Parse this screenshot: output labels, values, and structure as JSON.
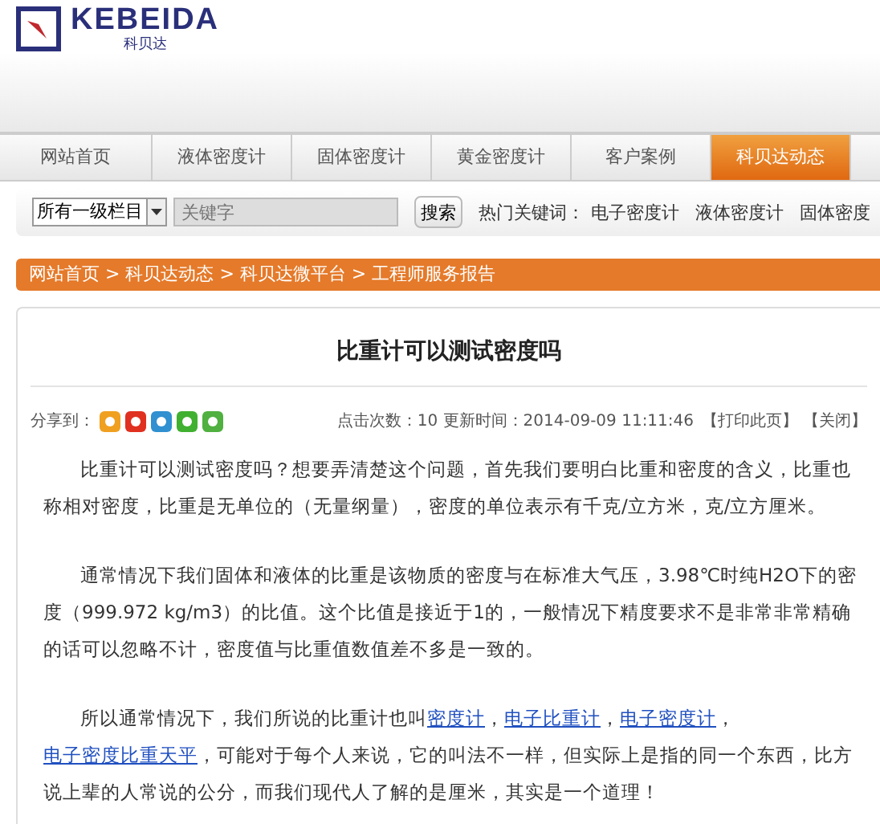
{
  "logo": {
    "name": "KEBEIDA",
    "subtitle": "科贝达"
  },
  "nav": [
    {
      "label": "网站首页",
      "selected": false
    },
    {
      "label": "液体密度计",
      "selected": false
    },
    {
      "label": "固体密度计",
      "selected": false
    },
    {
      "label": "黄金密度计",
      "selected": false
    },
    {
      "label": "客户案例",
      "selected": false
    },
    {
      "label": "科贝达动态",
      "selected": true
    }
  ],
  "search": {
    "category": "所有一级栏目",
    "placeholder": "关键字",
    "button": "搜索",
    "hot_label": "热门关键词：",
    "hot_keywords": [
      "电子密度计",
      "液体密度计",
      "固体密度"
    ]
  },
  "breadcrumb": "网站首页 > 科贝达动态 > 科贝达微平台 > 工程师服务报告",
  "article": {
    "title": "比重计可以测试密度吗",
    "share_label": "分享到：",
    "meta": "点击次数：10  更新时间：2014-09-09 11:11:46",
    "actions": [
      "【打印此页】",
      "【关闭】"
    ],
    "paragraphs": [
      [
        {
          "kind": "text",
          "text": "比重计可以测试密度吗？想要弄清楚这个问题，首先我们要明白比重和密度的含义，比重也称相对密度，比重是无单位的（无量纲量），密度的单位表示有千克/立方米，克/立方厘米。"
        }
      ],
      [
        {
          "kind": "text",
          "text": "通常情况下我们固体和液体的比重是该物质的密度与在标准大气压，3.98℃时纯H2O下的密度（999.972 kg/m3）的比值。这个比值是接近于1的，一般情况下精度要求不是非常非常精确的话可以忽略不计，密度值与比重值数值差不多是一致的。"
        }
      ],
      [
        {
          "kind": "text",
          "text": "所以通常情况下，我们所说的比重计也叫"
        },
        {
          "kind": "link",
          "text": "密度计"
        },
        {
          "kind": "text",
          "text": "，"
        },
        {
          "kind": "link",
          "text": "电子比重计"
        },
        {
          "kind": "text",
          "text": "，"
        },
        {
          "kind": "link",
          "text": "电子密度计"
        },
        {
          "kind": "text",
          "text": "，"
        },
        {
          "kind": "link",
          "text": "电子密度比重天平"
        },
        {
          "kind": "text",
          "text": "，可能对于每个人来说，它的叫法不一样，但实际上是指的同一个东西，比方说上辈的人常说的公分，而我们现代人了解的是厘米，其实是一个道理！"
        }
      ]
    ]
  }
}
